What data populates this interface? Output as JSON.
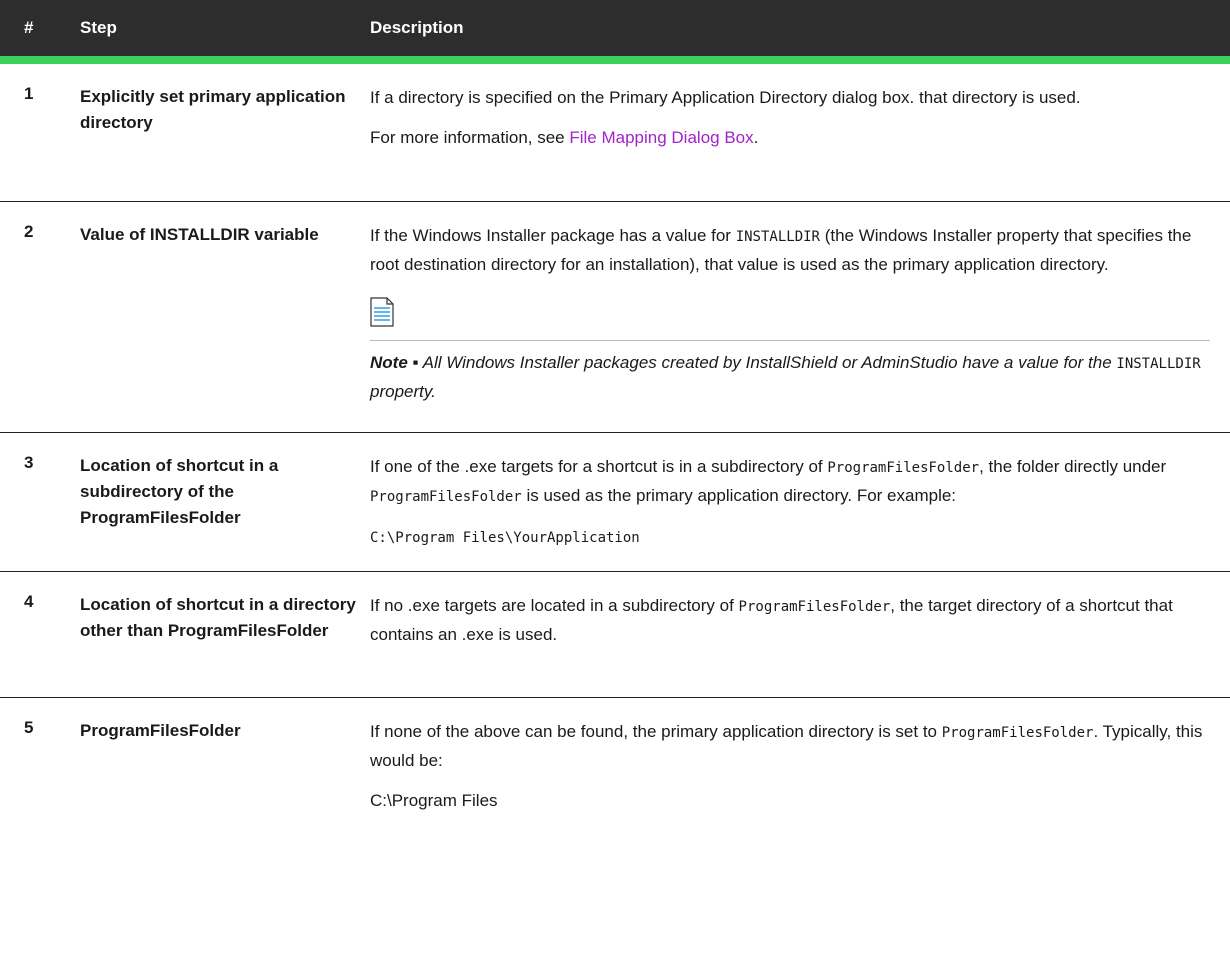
{
  "header": {
    "col_num": "#",
    "col_step": "Step",
    "col_desc": "Description"
  },
  "rows": [
    {
      "num": "1",
      "step": "Explicitly set primary application directory",
      "p1": "If a directory is specified on the Primary Application Directory dialog box. that directory is used.",
      "p2_prefix": "For more information, see ",
      "p2_link": "File Mapping Dialog Box",
      "p2_suffix": "."
    },
    {
      "num": "2",
      "step": "Value of INSTALLDIR variable",
      "p1_prefix": "If the Windows Installer package has a value for ",
      "p1_code": "INSTALLDIR",
      "p1_suffix": " (the Windows Installer property that specifies the root destination directory for an installation), that value is used as the primary application directory.",
      "note_icon": "document-note-icon",
      "note_label": "Note ▪",
      "note_text_prefix": " All Windows Installer packages created by InstallShield or AdminStudio have a value for the ",
      "note_code": "INSTALLDIR",
      "note_text_suffix": " property."
    },
    {
      "num": "3",
      "step": "Location of shortcut in a subdirectory of the ProgramFilesFolder",
      "p1_prefix": "If one of the .exe targets for a shortcut is in a subdirectory of ",
      "p1_code1": "ProgramFilesFolder",
      "p1_mid": ", the folder directly under ",
      "p1_code2": "ProgramFilesFolder",
      "p1_suffix": " is used as the primary application directory. For example:",
      "p2_code": "C:\\Program Files\\YourApplication"
    },
    {
      "num": "4",
      "step": "Location of shortcut in a directory other than ProgramFilesFolder",
      "p1_prefix": "If no .exe targets are located in a subdirectory of ",
      "p1_code": "ProgramFilesFolder",
      "p1_suffix": ", the target directory of a shortcut that contains an .exe is used."
    },
    {
      "num": "5",
      "step": "ProgramFilesFolder",
      "p1_prefix": "If none of the above can be found, the primary application directory is set to ",
      "p1_code": "ProgramFilesFolder",
      "p1_suffix": ". Typically, this would be:",
      "p2": "C:\\Program Files"
    }
  ]
}
